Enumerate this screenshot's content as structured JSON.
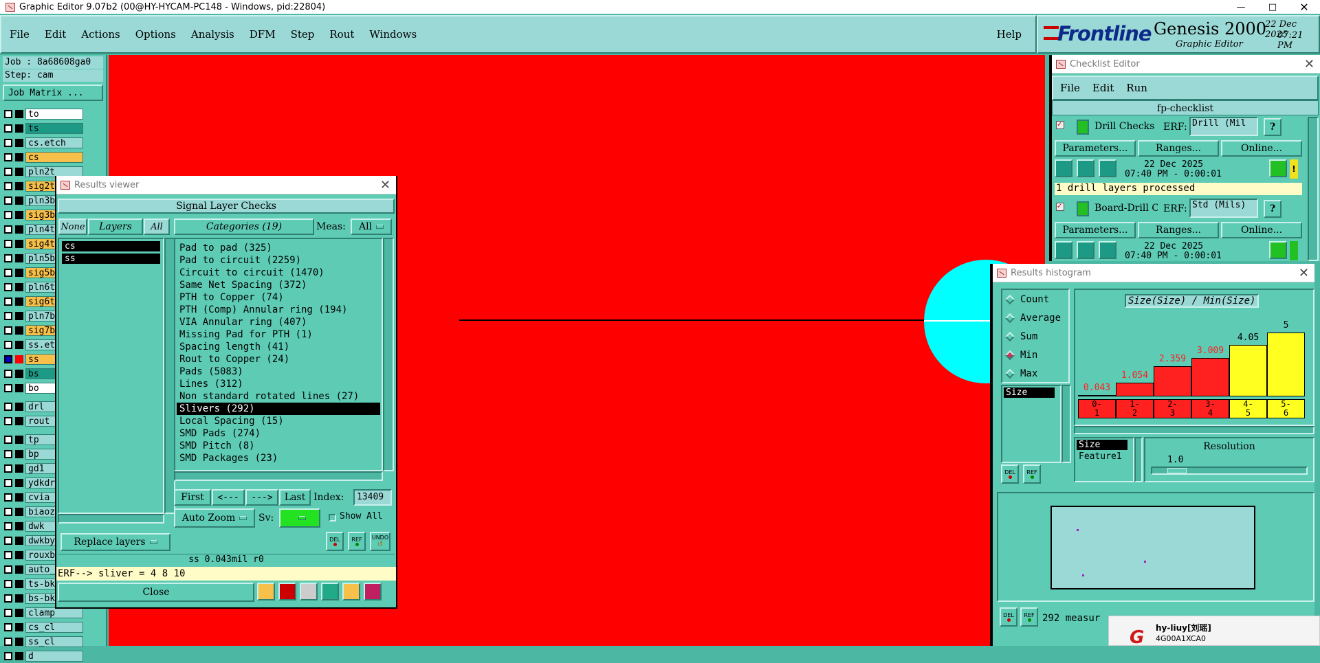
{
  "window": {
    "title": "Graphic Editor 9.07b2 (00@HY-HYCAM-PC148 - Windows, pid:22804)"
  },
  "menu": [
    "File",
    "Edit",
    "Actions",
    "Options",
    "Analysis",
    "DFM",
    "Step",
    "Rout",
    "Windows"
  ],
  "help": "Help",
  "brand": {
    "logo": "Frontline",
    "product": "Genesis 2000",
    "sub": "Graphic Editor",
    "date": "22 Dec 2025",
    "time": "07:21 PM"
  },
  "job": {
    "job": "Job : 8a68608ga0",
    "step": "Step: cam",
    "matrix_btn": "Job Matrix ..."
  },
  "layers": [
    {
      "name": "to",
      "color": "#ffffff"
    },
    {
      "name": "ts",
      "color": "#1c9a86"
    },
    {
      "name": "cs.etch",
      "color": "#9ad9d6"
    },
    {
      "name": "cs",
      "color": "#f7c04a"
    },
    {
      "name": "pln2t",
      "color": "#9ad9d6"
    },
    {
      "name": "sig2t",
      "color": "#f7c04a"
    },
    {
      "name": "pln3b",
      "color": "#9ad9d6"
    },
    {
      "name": "sig3b",
      "color": "#f7c04a"
    },
    {
      "name": "pln4t",
      "color": "#9ad9d6"
    },
    {
      "name": "sig4t",
      "color": "#f7c04a"
    },
    {
      "name": "pln5b",
      "color": "#9ad9d6"
    },
    {
      "name": "sig5b",
      "color": "#f7c04a"
    },
    {
      "name": "pln6t",
      "color": "#9ad9d6"
    },
    {
      "name": "sig6t",
      "color": "#f7c04a"
    },
    {
      "name": "pln7b",
      "color": "#9ad9d6"
    },
    {
      "name": "sig7b",
      "color": "#f7c04a"
    },
    {
      "name": "ss.etch",
      "color": "#9ad9d6"
    },
    {
      "name": "ss",
      "color": "#f7c04a"
    },
    {
      "name": "bs",
      "color": "#1c9a86"
    },
    {
      "name": "bo",
      "color": "#ffffff"
    },
    {
      "name": "drl",
      "color": "#9ad9d6"
    },
    {
      "name": "rout",
      "color": "#9ad9d6"
    },
    {
      "name": "tp",
      "color": "#9ad9d6"
    },
    {
      "name": "bp",
      "color": "#9ad9d6"
    },
    {
      "name": "gd1",
      "color": "#9ad9d6"
    },
    {
      "name": "ydkdr",
      "color": "#9ad9d6"
    },
    {
      "name": "cvia",
      "color": "#9ad9d6"
    },
    {
      "name": "biaoz",
      "color": "#9ad9d6"
    },
    {
      "name": "dwk",
      "color": "#9ad9d6"
    },
    {
      "name": "dwkby",
      "color": "#9ad9d6"
    },
    {
      "name": "rouxb",
      "color": "#9ad9d6"
    },
    {
      "name": "auto_",
      "color": "#9ad9d6"
    },
    {
      "name": "ts-bk",
      "color": "#9ad9d6"
    },
    {
      "name": "bs-bk",
      "color": "#9ad9d6"
    },
    {
      "name": "clamp",
      "color": "#9ad9d6"
    },
    {
      "name": "cs_cl",
      "color": "#9ad9d6"
    },
    {
      "name": "ss_cl",
      "color": "#9ad9d6"
    },
    {
      "name": "d",
      "color": "#9ad9d6"
    }
  ],
  "results_viewer": {
    "title": "Results viewer",
    "header": "Signal Layer Checks",
    "none": "None",
    "layers": "Layers",
    "all": "All",
    "categories": "Categories (19)",
    "meas_label": "Meas:",
    "meas_value": "All",
    "layer_items": [
      "cs",
      "ss"
    ],
    "categories_list": [
      "Pad to pad (325)",
      "Pad to circuit (2259)",
      "Circuit to circuit (1470)",
      "Same Net Spacing (372)",
      "PTH to Copper (74)",
      "PTH (Comp) Annular ring (194)",
      "VIA Annular ring (407)",
      "Missing Pad for PTH (1)",
      "Spacing length (41)",
      "Rout to Copper (24)",
      "Pads (5083)",
      "Lines (312)",
      "Non standard rotated lines (27)",
      "Slivers (292)",
      "Local Spacing (15)",
      "SMD Pads (274)",
      "SMD Pitch (8)",
      "SMD Packages (23)"
    ],
    "selected_category": "Slivers (292)",
    "first": "First",
    "prev": "<---",
    "next": "--->",
    "last": "Last",
    "index_label": "Index:",
    "index_value": "13409",
    "auto_zoom": "Auto Zoom",
    "sv": "Sv:",
    "show_all": "Show All",
    "replace_layers": "Replace layers",
    "del": "DEL",
    "ref": "REF",
    "undo": "UNDO",
    "status": "ss 0.043mil  r0",
    "erf": "ERF--> sliver = 4 8 10",
    "close": "Close"
  },
  "checklist": {
    "title": "Checklist Editor",
    "menu": [
      "File",
      "Edit",
      "Run"
    ],
    "name": "fp-checklist",
    "items": [
      {
        "name": "Drill Checks",
        "erf_label": "ERF:",
        "erf": "Drill (Mil",
        "params": "Parameters...",
        "ranges": "Ranges...",
        "online": "Online...",
        "date": "22 Dec 2025",
        "time": "07:40 PM - 0:00:01",
        "msg": "1 drill layers processed"
      },
      {
        "name": "Board-Drill Che",
        "erf_label": "ERF:",
        "erf": "Std (Mils)",
        "params": "Parameters...",
        "ranges": "Ranges...",
        "online": "Online...",
        "date": "22 Dec 2025",
        "time": "07:40 PM - 0:00:01"
      }
    ]
  },
  "histogram": {
    "title": "Results histogram",
    "options": [
      "Count",
      "Average",
      "Sum",
      "Min",
      "Max"
    ],
    "selected": "Min",
    "chart_title": "Size(Size) / Min(Size)",
    "list_item": "Size",
    "bars": [
      {
        "label": "0.043",
        "value": 0.043,
        "bin": "0-\n1",
        "color": "#ff2020"
      },
      {
        "label": "1.054",
        "value": 1.054,
        "bin": "1-\n2",
        "color": "#ff2020"
      },
      {
        "label": "2.359",
        "value": 2.359,
        "bin": "2-\n3",
        "color": "#ff2020"
      },
      {
        "label": "3.009",
        "value": 3.009,
        "bin": "3-\n4",
        "color": "#ff2020"
      },
      {
        "label": "4.05",
        "value": 4.05,
        "bin": "4-\n5",
        "color": "#ffff20"
      },
      {
        "label": "5",
        "value": 5,
        "bin": "5-\n6",
        "color": "#ffff20"
      }
    ],
    "sel_items": [
      "Size",
      "Feature1"
    ],
    "resolution_label": "Resolution",
    "resolution": "1.0",
    "measures": "292 measur"
  },
  "notify": {
    "user": "hy-liuy[刘瑶]",
    "code": "4G00A1XCA0"
  }
}
